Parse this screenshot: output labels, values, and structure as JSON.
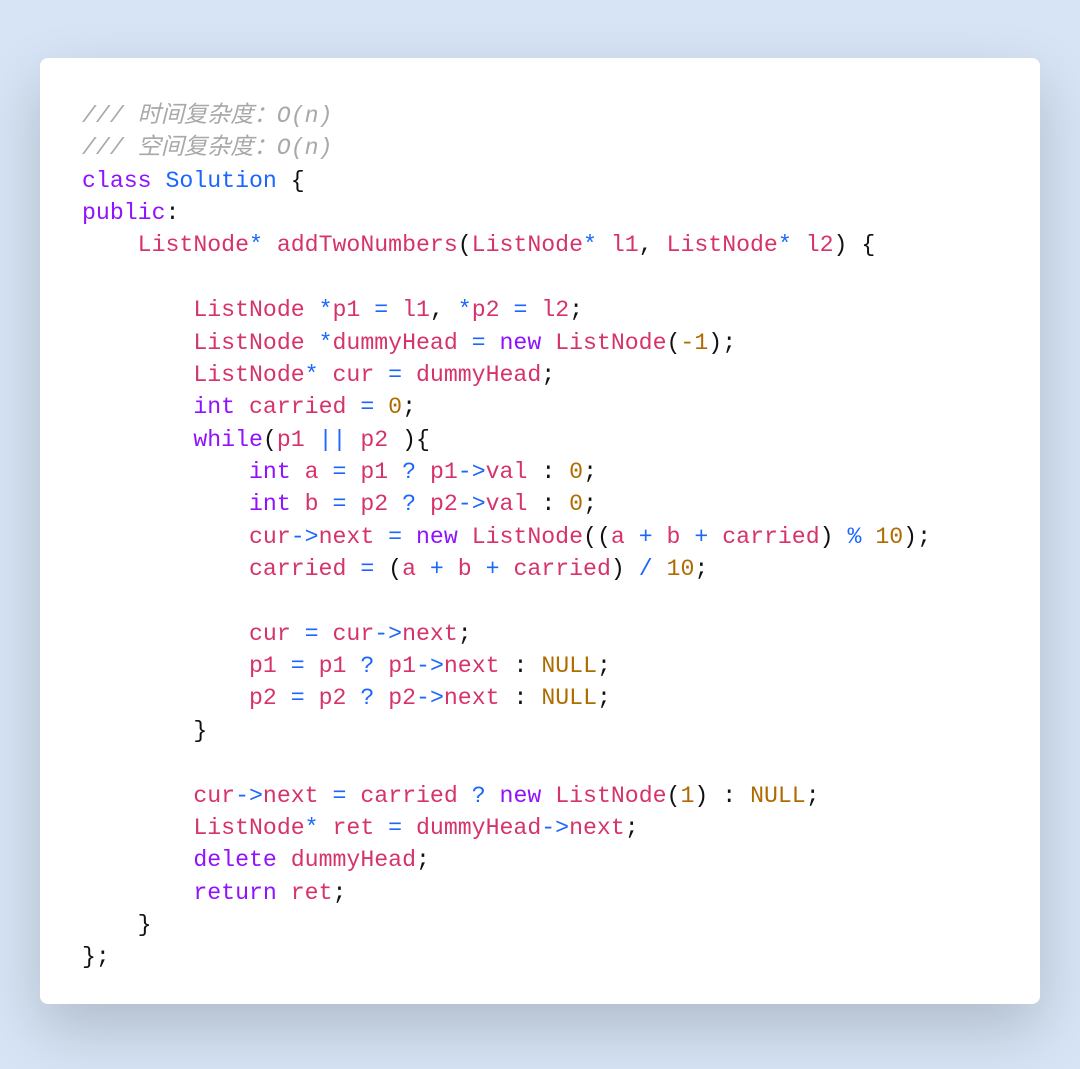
{
  "code": {
    "comment1": "/// 时间复杂度：O(n)",
    "comment2": "/// 空间复杂度：O(n)",
    "kw_class": "class",
    "cls_name": "Solution",
    "brace_open": "{",
    "kw_public": "public",
    "colon": ":",
    "indent1": "    ",
    "indent2": "        ",
    "indent3": "            ",
    "ty_ListNode": "ListNode",
    "star": "*",
    "fn_addTwoNumbers": "addTwoNumbers",
    "paren_open": "(",
    "paren_close": ")",
    "id_l1": "l1",
    "id_l2": "l2",
    "comma": ",",
    "space": " ",
    "id_p1": "p1",
    "id_p2": "p2",
    "eq": "=",
    "semi": ";",
    "id_dummyHead": "dummyHead",
    "kw_new": "new",
    "num_neg1": "-1",
    "id_cur": "cur",
    "kw_int": "int",
    "id_carried": "carried",
    "num_0": "0",
    "kw_while": "while",
    "op_or": "||",
    "id_a": "a",
    "id_b": "b",
    "qmark": "?",
    "arrow": "->",
    "id_val": "val",
    "colon2": ":",
    "id_next": "next",
    "plus": "+",
    "pct": "%",
    "num_10": "10",
    "slash": "/",
    "null": "NULL",
    "brace_close": "}",
    "num_1": "1",
    "id_ret": "ret",
    "kw_delete": "delete",
    "kw_return": "return",
    "end_semi": ";"
  }
}
